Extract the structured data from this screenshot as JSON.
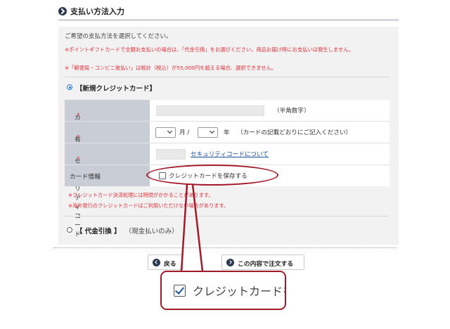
{
  "header": {
    "title": "支払い方法入力",
    "icon": "chevron-right-circle-icon"
  },
  "intro_text": "ご希望の支払方法を選択してください。",
  "notes": [
    "※ポイントギフトカードで全額お支払いの場合は、「代金引換」をお選びください。商品お届け時にお支払いは発生しません。",
    "※「郵便局・コンビニ後払い」は税計（税込）が55,000円を超える場合、選択できません。"
  ],
  "credit_option": {
    "label": "【新規クレジットカード】",
    "selected": true
  },
  "form": {
    "card_number": {
      "label": "カード番号",
      "required": "*",
      "hint": "（半角数字）",
      "value": ""
    },
    "expiry": {
      "label": "有効期限",
      "required": "*",
      "month_unit": "月 /",
      "year_unit": "年",
      "hint": "（カードの記載どおりにご記入ください）"
    },
    "security_code": {
      "label": "セキュリティコード",
      "required": "*",
      "link": "セキュリティコードについて",
      "value": ""
    },
    "card_info": {
      "label": "カード情報",
      "save_label": "クレジットカードを保存する",
      "checked": false
    }
  },
  "warnings": [
    "※クレジットカード決済処理には時間がかかることがあります。",
    "※海外発行のクレジットカードはご利用いただけない場合があります。"
  ],
  "cod_option": {
    "label": "【 代金引換 】",
    "sub": "（現金払いのみ）",
    "selected": false
  },
  "buttons": {
    "back": "戻る",
    "submit": "この内容で注文する"
  },
  "callout": {
    "text": "クレジットカードを",
    "checked": true
  },
  "colors": {
    "highlight": "#a21a2a",
    "note_red": "#e0303a",
    "link": "#1a4f9a",
    "table_header": "#c9cdd5"
  }
}
